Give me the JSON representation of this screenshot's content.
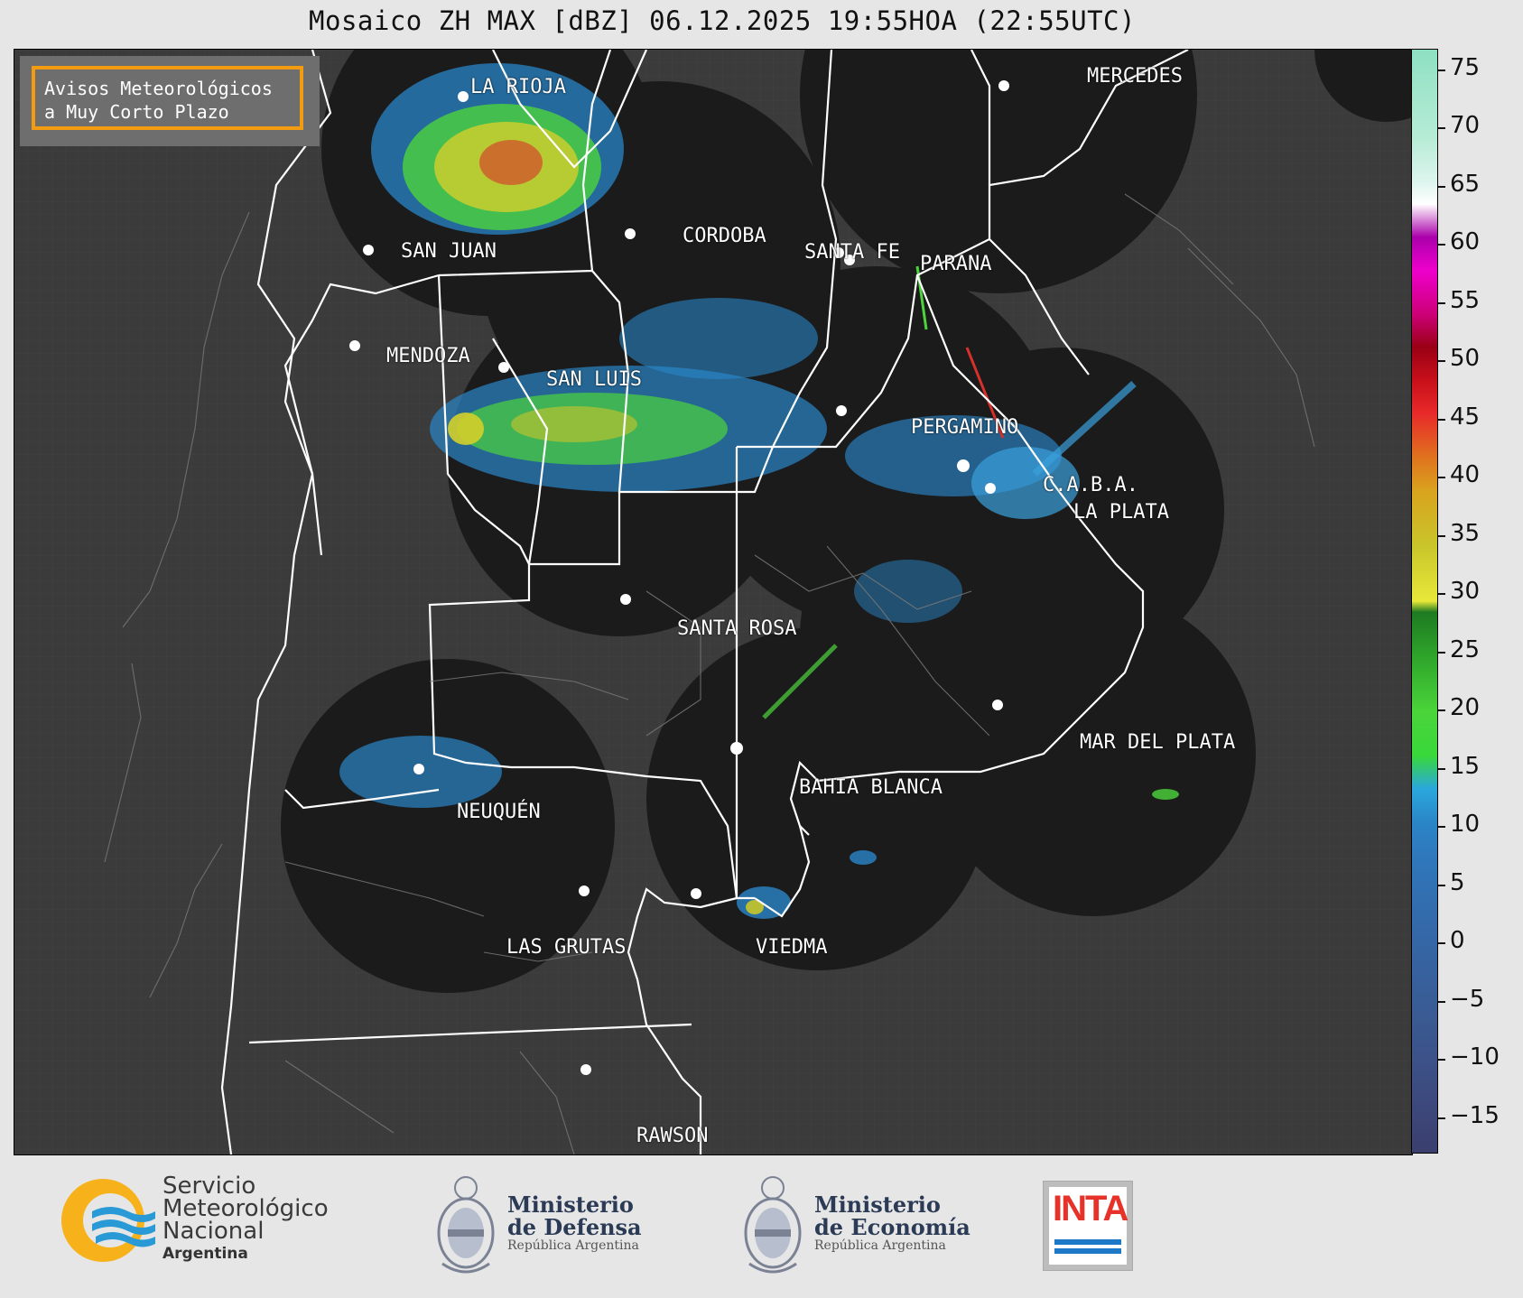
{
  "title": "Mosaico ZH MAX [dBZ] 06.12.2025 19:55HOA (22:55UTC)",
  "notice": {
    "line1": "Avisos Meteorológicos",
    "line2": "a Muy Corto Plazo",
    "border_color": "#f39c12"
  },
  "cities": [
    {
      "name": "LA RIOJA"
    },
    {
      "name": "SAN JUAN"
    },
    {
      "name": "CORDOBA"
    },
    {
      "name": "SANTA FE"
    },
    {
      "name": "PARANA"
    },
    {
      "name": "MERCEDES"
    },
    {
      "name": "MENDOZA"
    },
    {
      "name": "SAN LUIS"
    },
    {
      "name": "PERGAMINO"
    },
    {
      "name": "C.A.B.A."
    },
    {
      "name": "LA PLATA"
    },
    {
      "name": "SANTA ROSA"
    },
    {
      "name": "MAR DEL PLATA"
    },
    {
      "name": "BAHIA BLANCA"
    },
    {
      "name": "NEUQUÉN"
    },
    {
      "name": "LAS GRUTAS"
    },
    {
      "name": "VIEDMA"
    },
    {
      "name": "RAWSON"
    }
  ],
  "colorbar": {
    "ticks": [
      "75",
      "70",
      "65",
      "60",
      "55",
      "50",
      "45",
      "40",
      "35",
      "30",
      "25",
      "20",
      "15",
      "10",
      "5",
      "0",
      "−5",
      "−10",
      "−15"
    ],
    "range": [
      -18,
      77
    ]
  },
  "footer": {
    "smn": {
      "line1": "Servicio",
      "line2": "Meteorológico",
      "line3": "Nacional",
      "line4": "Argentina"
    },
    "defensa": {
      "line1": "Ministerio",
      "line2": "de Defensa",
      "line3": "República Argentina"
    },
    "economia": {
      "line1": "Ministerio",
      "line2": "de Economía",
      "line3": "República Argentina"
    },
    "inta": {
      "word": "INTA"
    }
  }
}
